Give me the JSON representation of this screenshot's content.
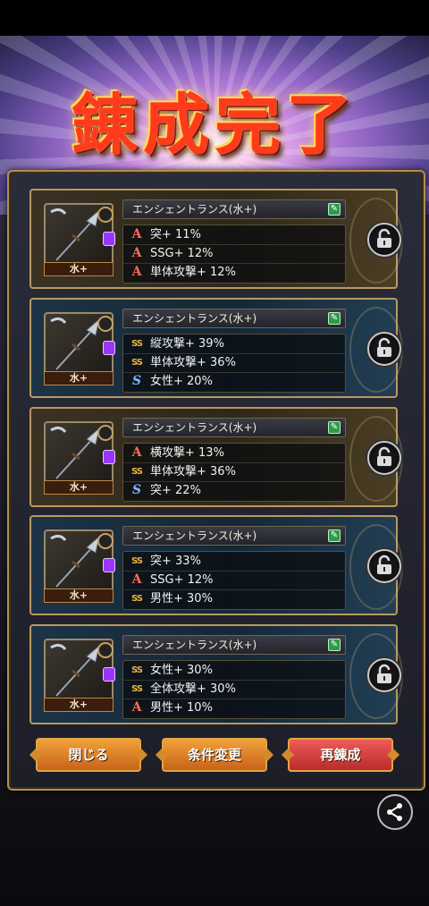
{
  "title": "錬成完了",
  "cards": [
    {
      "theme": "gold",
      "weapon_name": "エンシェントランス(水+)",
      "element": "水+",
      "stats": [
        {
          "rank": "A",
          "text": "突+ 11%"
        },
        {
          "rank": "A",
          "text": "SSG+ 12%"
        },
        {
          "rank": "A",
          "text": "単体攻撃+ 12%"
        }
      ]
    },
    {
      "theme": "blue",
      "weapon_name": "エンシェントランス(水+)",
      "element": "水+",
      "stats": [
        {
          "rank": "SS",
          "text": "縦攻撃+ 39%"
        },
        {
          "rank": "SS",
          "text": "単体攻撃+ 36%"
        },
        {
          "rank": "S",
          "text": "女性+ 20%"
        }
      ]
    },
    {
      "theme": "gold",
      "weapon_name": "エンシェントランス(水+)",
      "element": "水+",
      "stats": [
        {
          "rank": "A",
          "text": "横攻撃+ 13%"
        },
        {
          "rank": "SS",
          "text": "単体攻撃+ 36%"
        },
        {
          "rank": "S",
          "text": "突+ 22%"
        }
      ]
    },
    {
      "theme": "blue",
      "weapon_name": "エンシェントランス(水+)",
      "element": "水+",
      "stats": [
        {
          "rank": "SS",
          "text": "突+ 33%"
        },
        {
          "rank": "A",
          "text": "SSG+ 12%"
        },
        {
          "rank": "SS",
          "text": "男性+ 30%"
        }
      ]
    },
    {
      "theme": "blue",
      "weapon_name": "エンシェントランス(水+)",
      "element": "水+",
      "stats": [
        {
          "rank": "SS",
          "text": "女性+ 30%"
        },
        {
          "rank": "SS",
          "text": "全体攻撃+ 30%"
        },
        {
          "rank": "A",
          "text": "男性+ 10%"
        }
      ]
    }
  ],
  "buttons": {
    "close": "閉じる",
    "change_conditions": "条件変更",
    "re_synthesize": "再錬成"
  },
  "icons": {
    "lock": "unlocked-padlock-icon",
    "edit": "edit-icon",
    "share": "share-icon",
    "gem": "purple-gem-icon",
    "wrench": "wrench-icon"
  },
  "colors": {
    "title": "#ff3b1a",
    "rank_A": "#ff6b56",
    "rank_SS": "#e6b53a",
    "rank_S": "#7fb3ff",
    "button_orange": "#e08a2e",
    "button_red": "#d8423f"
  }
}
